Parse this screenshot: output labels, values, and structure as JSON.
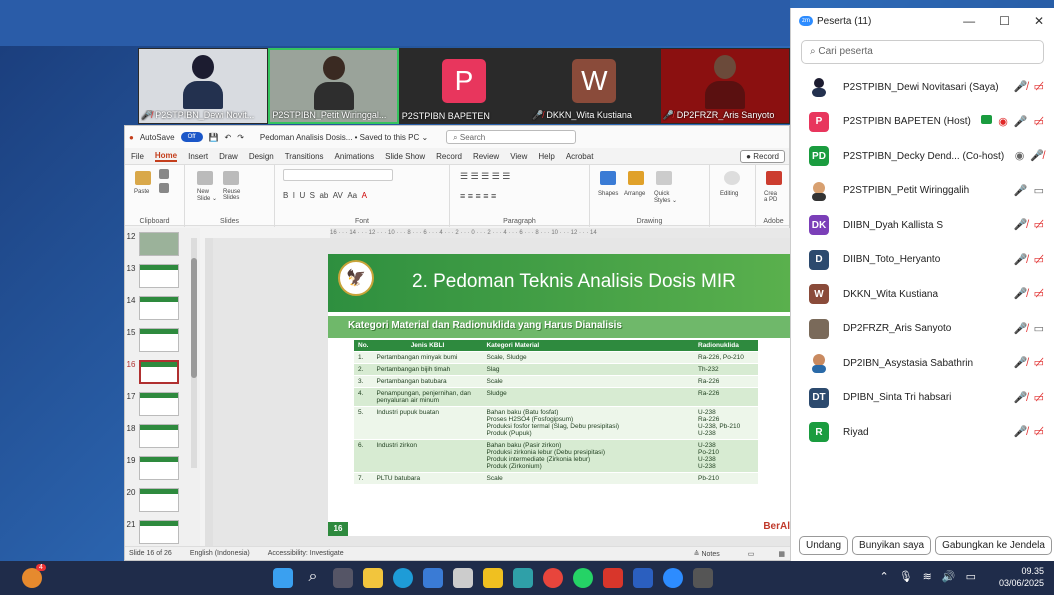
{
  "video_tiles": [
    {
      "name": "P2STPIBN_Dewi Novit...",
      "muted": true
    },
    {
      "name": "P2STPIBN_Petit Wiringgal...",
      "muted": false
    },
    {
      "name": "P2STPIBN BAPETEN",
      "letter": "P",
      "color": "#e8365d",
      "muted": false
    },
    {
      "name": "DKKN_Wita Kustiana",
      "letter": "W",
      "color": "#8a4b3a",
      "muted": true
    },
    {
      "name": "DP2FRZR_Aris Sanyoto",
      "muted": true
    }
  ],
  "ppt": {
    "autosave": "AutoSave",
    "toggle": "Off",
    "doc_title": "Pedoman Analisis Dosis... • Saved to this PC ⌄",
    "search": "Search",
    "menu": [
      "File",
      "Home",
      "Insert",
      "Draw",
      "Design",
      "Transitions",
      "Animations",
      "Slide Show",
      "Record",
      "Review",
      "View",
      "Help",
      "Acrobat"
    ],
    "record": "● Record",
    "groups": {
      "clipboard": "Clipboard",
      "slides": "Slides",
      "font": "Font",
      "paragraph": "Paragraph",
      "drawing": "Drawing",
      "adobe": "Adobe"
    },
    "ribbon_labels": {
      "paste": "Paste",
      "new_slide": "New\nSlide ⌄",
      "reuse": "Reuse\nSlides",
      "shapes": "Shapes",
      "arrange": "Arrange",
      "quick": "Quick\nStyles ⌄",
      "editing": "Editing",
      "create": "Crea\na PD"
    },
    "ruler": "16 · · · 14 · · · 12 · · · 10 · · · 8 · · · 6 · · · 4 · · · 2 · · · 0 · · · 2 · · · 4 · · · 6 · · · 8 · · · 10 · · · 12 · · · 14",
    "thumb_numbers": [
      "12",
      "13",
      "14",
      "15",
      "16",
      "17",
      "18",
      "19",
      "20",
      "21"
    ],
    "status": {
      "slide": "Slide 16 of 26",
      "lang": "English (Indonesia)",
      "access": "Accessibility: Investigate",
      "notes": "≜ Notes"
    }
  },
  "slide": {
    "title": "2. Pedoman Teknis Analisis Dosis MIR",
    "subtitle": "Kategori Material dan Radionuklida yang Harus Dianalisis",
    "number": "16",
    "footer": "BerAl",
    "headers": [
      "No.",
      "Jenis KBLI",
      "Kategori Material",
      "Radionuklida"
    ],
    "rows": [
      [
        "1.",
        "Pertambangan minyak bumi",
        "Scale, Sludge",
        "Ra-226, Po-210"
      ],
      [
        "2.",
        "Pertambangan bijih timah",
        "Slag",
        "Th-232"
      ],
      [
        "3.",
        "Pertambangan batubara",
        "Scale",
        "Ra-226"
      ],
      [
        "4.",
        "Penampungan, penjernihan, dan penyaluran air minum",
        "Sludge",
        "Ra-226"
      ],
      [
        "5.",
        "Industri pupuk buatan",
        "Bahan baku (Batu fosfat)\nProses H2SO4 (Fosfogipsum)\nProduksi fosfor termal (Slag, Debu presipitasi)\nProduk (Pupuk)",
        "U-238\nRa-226\nU-238, Pb-210\nU-238"
      ],
      [
        "6.",
        "Industri zirkon",
        "Bahan baku (Pasir zirkon)\nProduksi zirkonia lebur (Debu presipitasi)\nProduk intermediate (Zirkonia lebur)\nProduk (Zirkonium)",
        "U-238\nPo-210\nU-238\nU-238"
      ],
      [
        "7.",
        "PLTU batubara",
        "Scale",
        "Pb-210"
      ]
    ]
  },
  "participants": {
    "title": "Peserta (11)",
    "search_placeholder": "Cari peserta",
    "list": [
      {
        "name": "P2STPIBN_Dewi Novitasari (Saya)",
        "icons": "🎤̸ 🎥̸"
      },
      {
        "name": "P2STPIBN BAPETEN (Host)",
        "letter": "P",
        "color": "#e8365d"
      },
      {
        "name": "P2STPIBN_Decky Dend... (Co-host)",
        "letter": "PD",
        "color": "#1a9c3f"
      },
      {
        "name": "P2STPIBN_Petit Wiringgalih"
      },
      {
        "name": "DIIBN_Dyah Kallista S",
        "letter": "DK",
        "color": "#7b3fb8"
      },
      {
        "name": "DIIBN_Toto_Heryanto",
        "letter": "D",
        "color": "#2c4a6e"
      },
      {
        "name": "DKKN_Wita Kustiana",
        "letter": "W",
        "color": "#8a4b3a"
      },
      {
        "name": "DP2FRZR_Aris Sanyoto"
      },
      {
        "name": "DP2IBN_Asystasia Sabathrin"
      },
      {
        "name": "DPIBN_Sinta Tri habsari",
        "letter": "DT",
        "color": "#2c4a6e"
      },
      {
        "name": "Riyad",
        "letter": "R",
        "color": "#1a9c3f"
      }
    ],
    "buttons": [
      "Undang",
      "Bunyikan saya",
      "Gabungkan ke Jendela"
    ]
  },
  "taskbar": {
    "time": "09.35",
    "date": "03/06/2025",
    "badge": "4"
  }
}
